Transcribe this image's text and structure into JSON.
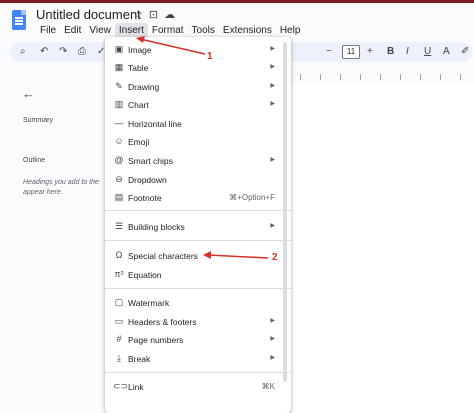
{
  "app": {
    "title": "Untitled document",
    "title_icons": [
      "star-icon",
      "move-folder-icon",
      "cloud-status-icon"
    ],
    "accent_color": "#7d1a24"
  },
  "menubar": [
    "File",
    "Edit",
    "View",
    "Insert",
    "Format",
    "Tools",
    "Extensions",
    "Help"
  ],
  "toolbar": {
    "font_size": "11"
  },
  "sidebar": {
    "summary_label": "Summary",
    "outline_label": "Outline",
    "outline_hint_1": "Headings you add to the",
    "outline_hint_2": "appear here."
  },
  "insert_menu": {
    "items": [
      {
        "icon": "image-icon",
        "glyph": "▣",
        "label": "Image",
        "submenu": true
      },
      {
        "icon": "table-icon",
        "glyph": "▦",
        "label": "Table",
        "submenu": true
      },
      {
        "icon": "drawing-icon",
        "glyph": "✎",
        "label": "Drawing",
        "submenu": true
      },
      {
        "icon": "chart-icon",
        "glyph": "▥",
        "label": "Chart",
        "submenu": true
      },
      {
        "icon": "horizontal-line-icon",
        "glyph": "—",
        "label": "Horizontal line",
        "submenu": false
      },
      {
        "icon": "emoji-icon",
        "glyph": "☺",
        "label": "Emoji",
        "submenu": false
      },
      {
        "icon": "smart-chips-icon",
        "glyph": "@",
        "label": "Smart chips",
        "submenu": true
      },
      {
        "icon": "dropdown-icon",
        "glyph": "⊖",
        "label": "Dropdown",
        "submenu": false
      },
      {
        "icon": "footnote-icon",
        "glyph": "▤",
        "label": "Footnote",
        "shortcut": "⌘+Option+F"
      },
      {
        "icon": "building-blocks-icon",
        "glyph": "☰",
        "label": "Building blocks",
        "submenu": true
      },
      {
        "icon": "special-characters-icon",
        "glyph": "Ω",
        "label": "Special characters",
        "submenu": false
      },
      {
        "icon": "equation-icon",
        "glyph": "π²",
        "label": "Equation",
        "submenu": false
      },
      {
        "icon": "watermark-icon",
        "glyph": "▢",
        "label": "Watermark",
        "submenu": false
      },
      {
        "icon": "headers-footers-icon",
        "glyph": "▭",
        "label": "Headers & footers",
        "submenu": true
      },
      {
        "icon": "page-numbers-icon",
        "glyph": "#",
        "label": "Page numbers",
        "submenu": true
      },
      {
        "icon": "break-icon",
        "glyph": "⤓",
        "label": "Break",
        "submenu": true
      },
      {
        "icon": "link-icon",
        "glyph": "⊂⊃",
        "label": "Link",
        "shortcut": "⌘K"
      }
    ]
  },
  "annotations": {
    "label_1": "1",
    "label_2": "2",
    "color": "#d93025"
  }
}
